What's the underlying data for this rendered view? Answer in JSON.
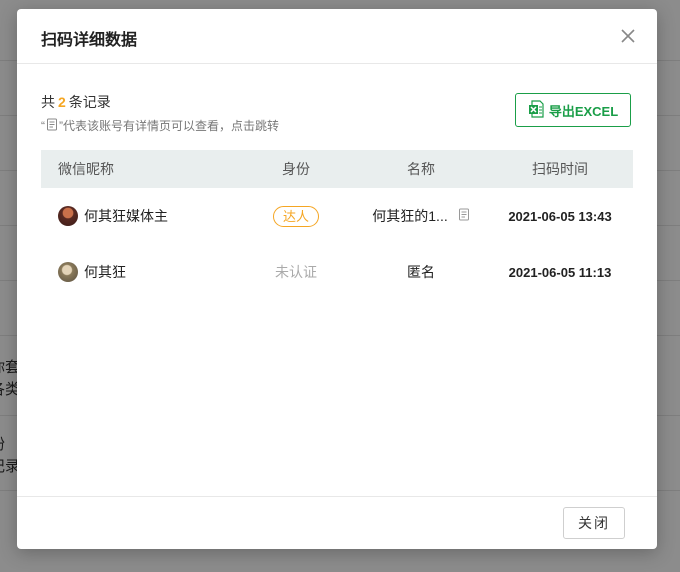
{
  "background": {
    "texts": [
      "你套",
      "各类",
      "粉",
      "记录"
    ]
  },
  "modal": {
    "title": "扫码详细数据",
    "close_icon": "close-icon",
    "summary": {
      "prefix": "共",
      "count": "2",
      "suffix": "条记录"
    },
    "hint": {
      "before": "“",
      "after": "”代表该账号有详情页可以查看，点击跳转"
    },
    "export_button": "导出EXCEL",
    "table": {
      "headers": [
        "微信昵称",
        "身份",
        "名称",
        "扫码时间"
      ],
      "rows": [
        {
          "nickname": "何其狂媒体主",
          "identity": "达人",
          "name": "何其狂的1...",
          "time": "2021-06-05 13:43"
        },
        {
          "nickname": "何其狂",
          "identity": "未认证",
          "name": "匿名",
          "time": "2021-06-05 11:13"
        }
      ]
    },
    "footer": {
      "close_button": "关闭"
    }
  },
  "colors": {
    "accent_orange": "#f5a623",
    "excel_green": "#1a9e48",
    "header_bg": "#e9eeee"
  }
}
